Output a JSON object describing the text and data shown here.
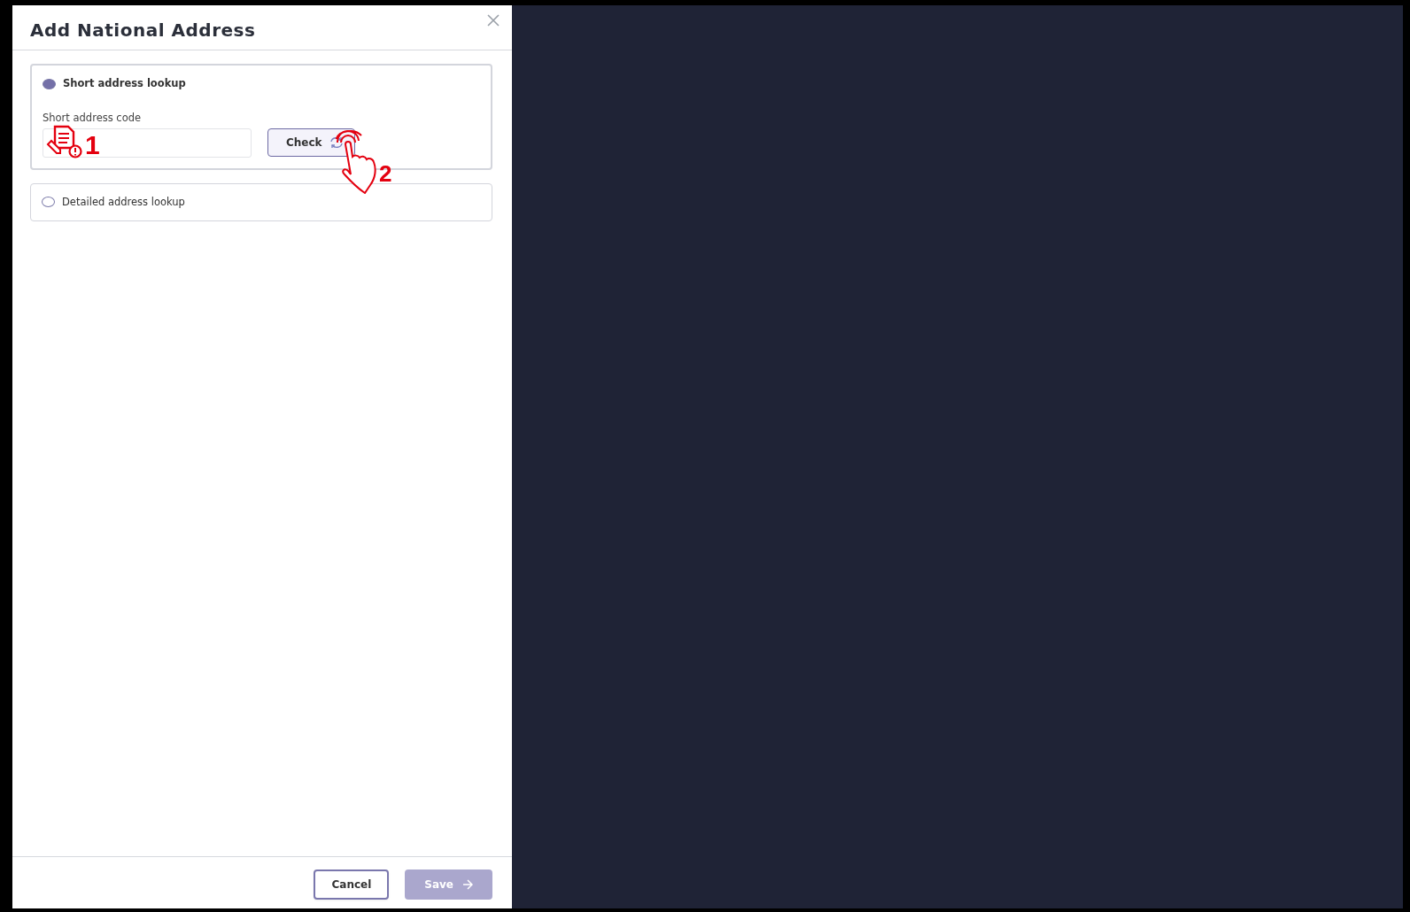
{
  "modal": {
    "title": "Add National Address"
  },
  "options": [
    {
      "label": "Short address lookup",
      "selected": true,
      "field_label": "Short address code",
      "button_label": "Check"
    },
    {
      "label": "Detailed address lookup",
      "selected": false
    }
  ],
  "annotations": [
    {
      "kind": "document",
      "number": "1"
    },
    {
      "kind": "hand",
      "number": "2"
    }
  ],
  "footer": {
    "buttons": [
      {
        "label": "Cancel",
        "kind": "outline",
        "disabled": false
      },
      {
        "label": "Save",
        "kind": "primary",
        "disabled": true
      }
    ]
  }
}
